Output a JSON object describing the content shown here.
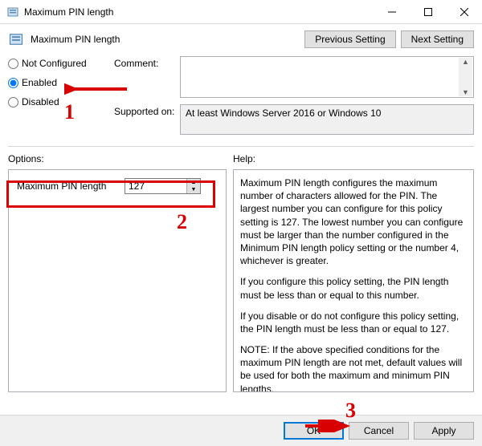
{
  "window": {
    "title": "Maximum PIN length",
    "icon": "policy-icon"
  },
  "header": {
    "title": "Maximum PIN length",
    "previous_btn": "Previous Setting",
    "next_btn": "Next Setting"
  },
  "state": {
    "not_configured": "Not Configured",
    "enabled": "Enabled",
    "disabled": "Disabled",
    "selected": "enabled"
  },
  "comment": {
    "label": "Comment:",
    "value": ""
  },
  "supported": {
    "label": "Supported on:",
    "value": "At least Windows Server 2016 or Windows 10"
  },
  "options": {
    "label": "Options:",
    "pin_length_label": "Maximum PIN length",
    "pin_length_value": "127"
  },
  "help": {
    "label": "Help:",
    "p1": "Maximum PIN length configures the maximum number of characters allowed for the PIN.  The largest number you can configure for this policy setting is 127. The lowest number you can configure must be larger than the number configured in the Minimum PIN length policy setting or the number 4, whichever is greater.",
    "p2": "If you configure this policy setting, the PIN length must be less than or equal to this number.",
    "p3": "If you disable or do not configure this policy setting, the PIN length must be less than or equal to 127.",
    "p4": "NOTE: If the above specified conditions for the maximum PIN length are not met, default values will be used for both the maximum and minimum PIN lengths."
  },
  "footer": {
    "ok": "OK",
    "cancel": "Cancel",
    "apply": "Apply"
  },
  "annotations": {
    "1": "1",
    "2": "2",
    "3": "3"
  }
}
